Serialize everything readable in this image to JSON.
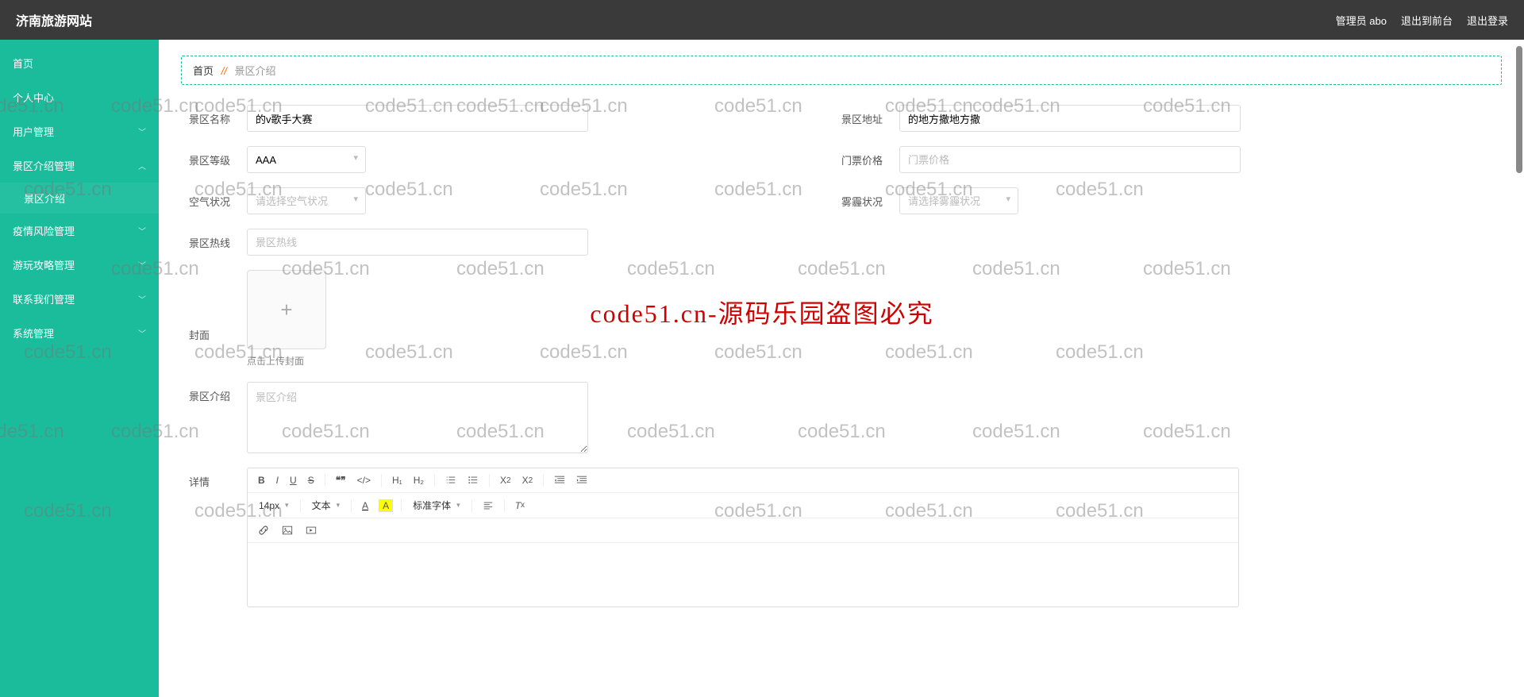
{
  "header": {
    "site_title": "济南旅游网站",
    "admin_label": "管理员 abo",
    "back_front": "退出到前台",
    "logout": "退出登录"
  },
  "sidebar": {
    "items": [
      {
        "label": "首页",
        "has_sub": false
      },
      {
        "label": "个人中心",
        "has_sub": false
      },
      {
        "label": "用户管理",
        "has_sub": true,
        "open": false
      },
      {
        "label": "景区介绍管理",
        "has_sub": true,
        "open": true,
        "sub": [
          {
            "label": "景区介绍"
          }
        ]
      },
      {
        "label": "疫情风险管理",
        "has_sub": true,
        "open": false
      },
      {
        "label": "游玩攻略管理",
        "has_sub": true,
        "open": false
      },
      {
        "label": "联系我们管理",
        "has_sub": true,
        "open": false
      },
      {
        "label": "系统管理",
        "has_sub": true,
        "open": false
      }
    ]
  },
  "breadcrumb": {
    "home": "首页",
    "sep": "//",
    "current": "景区介绍"
  },
  "form": {
    "name_label": "景区名称",
    "name_value": "的v歌手大赛",
    "address_label": "景区地址",
    "address_value": "的地方撒地方撒",
    "level_label": "景区等级",
    "level_value": "AAA",
    "price_label": "门票价格",
    "price_placeholder": "门票价格",
    "price_value": "",
    "air_label": "空气状况",
    "air_placeholder": "请选择空气状况",
    "haze_label": "雾霾状况",
    "haze_placeholder": "请选择雾霾状况",
    "hotline_label": "景区热线",
    "hotline_placeholder": "景区热线",
    "cover_label": "封面",
    "cover_hint": "点击上传封面",
    "intro_label": "景区介绍",
    "intro_placeholder": "景区介绍",
    "detail_label": "详情"
  },
  "editor": {
    "font_size": "14px",
    "block": "文本",
    "font_family": "标准字体",
    "h1": "H₁",
    "h2": "H₂"
  },
  "watermark": {
    "text": "code51.cn",
    "center_text": "code51.cn-源码乐园盗图必究"
  }
}
